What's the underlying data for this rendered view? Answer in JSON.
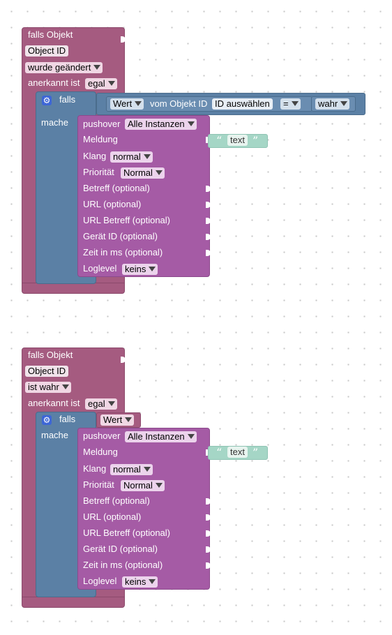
{
  "blocks": [
    {
      "trigger": {
        "title": "falls Objekt",
        "object_id": "Object ID",
        "condition": "wurde geändert",
        "ack_label": "anerkannt ist",
        "ack_value": "egal"
      },
      "if": {
        "if_label": "falls",
        "do_label": "mache",
        "value_dropdown": "Wert",
        "of_object_label": "vom Objekt ID",
        "object_select": "ID auswählen",
        "operator": "=",
        "compare_value": "wahr"
      },
      "pushover": {
        "label": "pushover",
        "instance": "Alle Instanzen",
        "message_label": "Meldung",
        "text_value": "text",
        "sound_label": "Klang",
        "sound_value": "normal",
        "priority_label": "Priorität",
        "priority_value": "Normal",
        "subject_label": "Betreff (optional)",
        "url_label": "URL (optional)",
        "url_subject_label": "URL Betreff (optional)",
        "device_label": "Gerät ID (optional)",
        "time_label": "Zeit in ms (optional)",
        "loglevel_label": "Loglevel",
        "loglevel_value": "keins"
      }
    },
    {
      "trigger": {
        "title": "falls Objekt",
        "object_id": "Object ID",
        "condition": "ist wahr",
        "ack_label": "anerkannt ist",
        "ack_value": "egal"
      },
      "if": {
        "if_label": "falls",
        "do_label": "mache",
        "value_dropdown": "Wert"
      },
      "pushover": {
        "label": "pushover",
        "instance": "Alle Instanzen",
        "message_label": "Meldung",
        "text_value": "text",
        "sound_label": "Klang",
        "sound_value": "normal",
        "priority_label": "Priorität",
        "priority_value": "Normal",
        "subject_label": "Betreff (optional)",
        "url_label": "URL (optional)",
        "url_subject_label": "URL Betreff (optional)",
        "device_label": "Gerät ID (optional)",
        "time_label": "Zeit in ms (optional)",
        "loglevel_label": "Loglevel",
        "loglevel_value": "keins"
      }
    }
  ],
  "colors": {
    "trigger_block": "#a55b80",
    "logic_block": "#5b80a5",
    "pushover_block": "#a55ba5",
    "text_block": "#a5d6c6",
    "gear_icon": "#3d66d6"
  }
}
